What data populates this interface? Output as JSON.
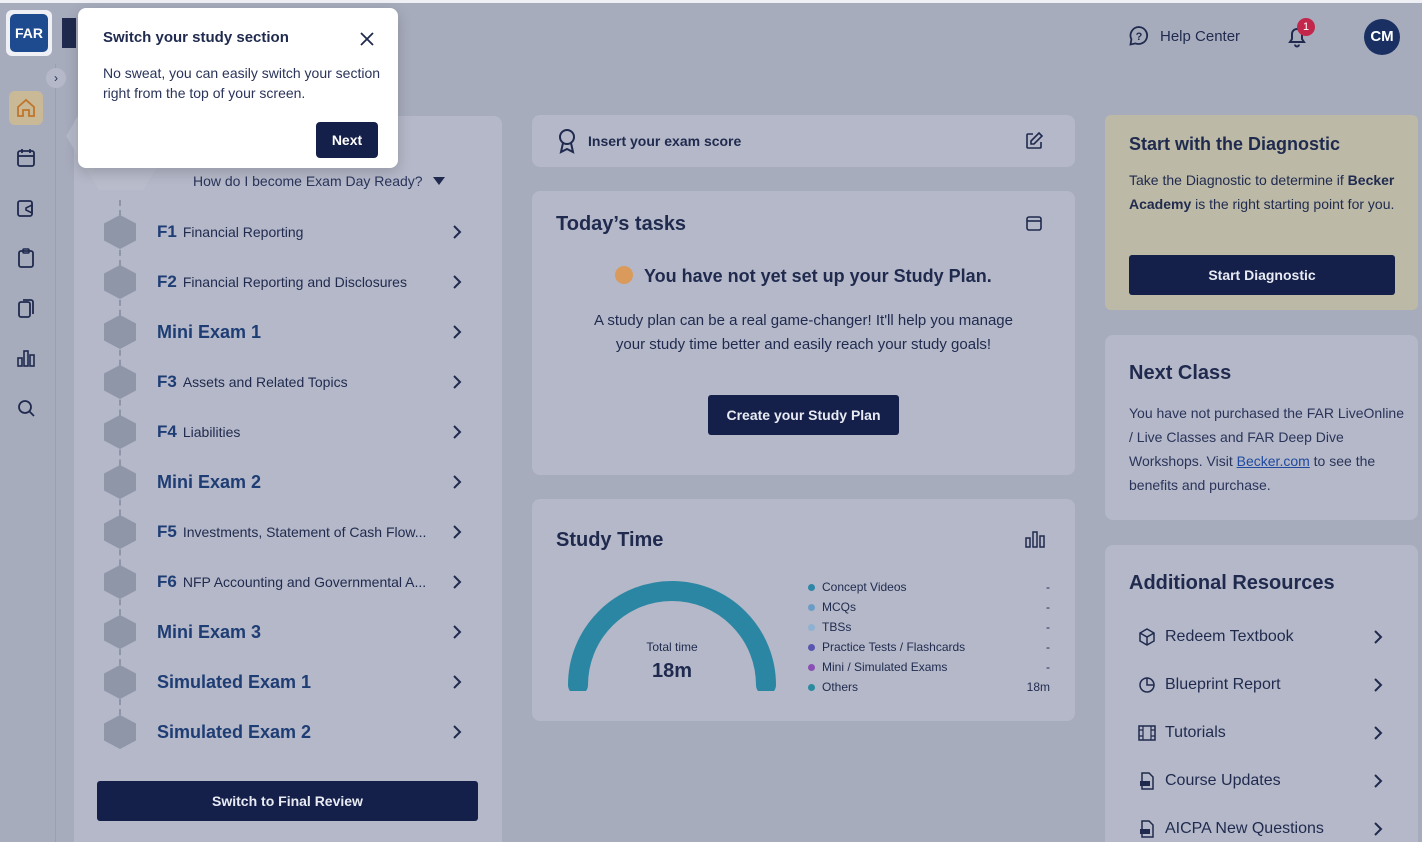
{
  "header": {
    "help_label": "Help Center",
    "notification_count": "1",
    "avatar_initials": "CM"
  },
  "nav": {
    "section_badge": "FAR",
    "icons": [
      "home-icon",
      "calendar-icon",
      "video-calendar-icon",
      "clipboard-icon",
      "flashcards-icon",
      "bar-chart-icon",
      "search-icon"
    ]
  },
  "popover": {
    "title": "Switch your study section",
    "body": "No sweat, you can easily switch your section right from the top of your screen.",
    "next_label": "Next"
  },
  "course": {
    "exam_ready_label": "How do I become Exam Day Ready?",
    "items": [
      {
        "code": "F1",
        "title": "Financial Reporting"
      },
      {
        "code": "F2",
        "title": "Financial Reporting and Disclosures"
      },
      {
        "code": "",
        "title": "Mini Exam 1"
      },
      {
        "code": "F3",
        "title": "Assets and Related Topics"
      },
      {
        "code": "F4",
        "title": "Liabilities"
      },
      {
        "code": "",
        "title": "Mini Exam 2"
      },
      {
        "code": "F5",
        "title": "Investments, Statement of Cash Flow..."
      },
      {
        "code": "F6",
        "title": "NFP Accounting and Governmental A..."
      },
      {
        "code": "",
        "title": "Mini Exam 3"
      },
      {
        "code": "",
        "title": "Simulated Exam 1"
      },
      {
        "code": "",
        "title": "Simulated Exam 2"
      }
    ],
    "final_review_label": "Switch to Final Review"
  },
  "exam_score": {
    "label": "Insert your exam score"
  },
  "tasks": {
    "title": "Today’s tasks",
    "not_set_label": "You have not yet set up your Study Plan.",
    "description": "A study plan can be a real game-changer! It'll help you manage your study time better and easily reach your study goals!",
    "button_label": "Create your Study Plan"
  },
  "study_time": {
    "title": "Study Time",
    "total_label": "Total time",
    "total_value": "18m",
    "legend": [
      {
        "name": "Concept Videos",
        "value": "-",
        "color": "#2e86a8"
      },
      {
        "name": "MCQs",
        "value": "-",
        "color": "#6b9cc7"
      },
      {
        "name": "TBSs",
        "value": "-",
        "color": "#8fb1d2"
      },
      {
        "name": "Practice Tests / Flashcards",
        "value": "-",
        "color": "#5a55b0"
      },
      {
        "name": "Mini / Simulated Exams",
        "value": "-",
        "color": "#8a4fb5"
      },
      {
        "name": "Others",
        "value": "18m",
        "color": "#2a8aa0"
      }
    ],
    "gauge_color": "#2a86a3"
  },
  "diagnostic": {
    "title": "Start with the Diagnostic",
    "desc_pre": "Take the Diagnostic to determine if ",
    "desc_bold": "Becker Academy",
    "desc_post": " is the right starting point for you.",
    "button_label": "Start Diagnostic"
  },
  "next_class": {
    "title": "Next Class",
    "desc_pre": "You have not purchased the FAR LiveOnline / Live Classes and FAR Deep Dive Workshops. Visit ",
    "link": "Becker.com",
    "desc_post": " to see the benefits and purchase."
  },
  "resources": {
    "title": "Additional Resources",
    "items": [
      {
        "label": "Redeem Textbook",
        "icon": "box-icon"
      },
      {
        "label": "Blueprint Report",
        "icon": "pie-chart-icon"
      },
      {
        "label": "Tutorials",
        "icon": "film-icon"
      },
      {
        "label": "Course Updates",
        "icon": "pdf-icon"
      },
      {
        "label": "AICPA New Questions",
        "icon": "pdf-icon"
      }
    ]
  },
  "colors": {
    "primary_button": "#15204a",
    "diagnostic_bg": "#bcb9a6",
    "notification": "#c2274b"
  }
}
